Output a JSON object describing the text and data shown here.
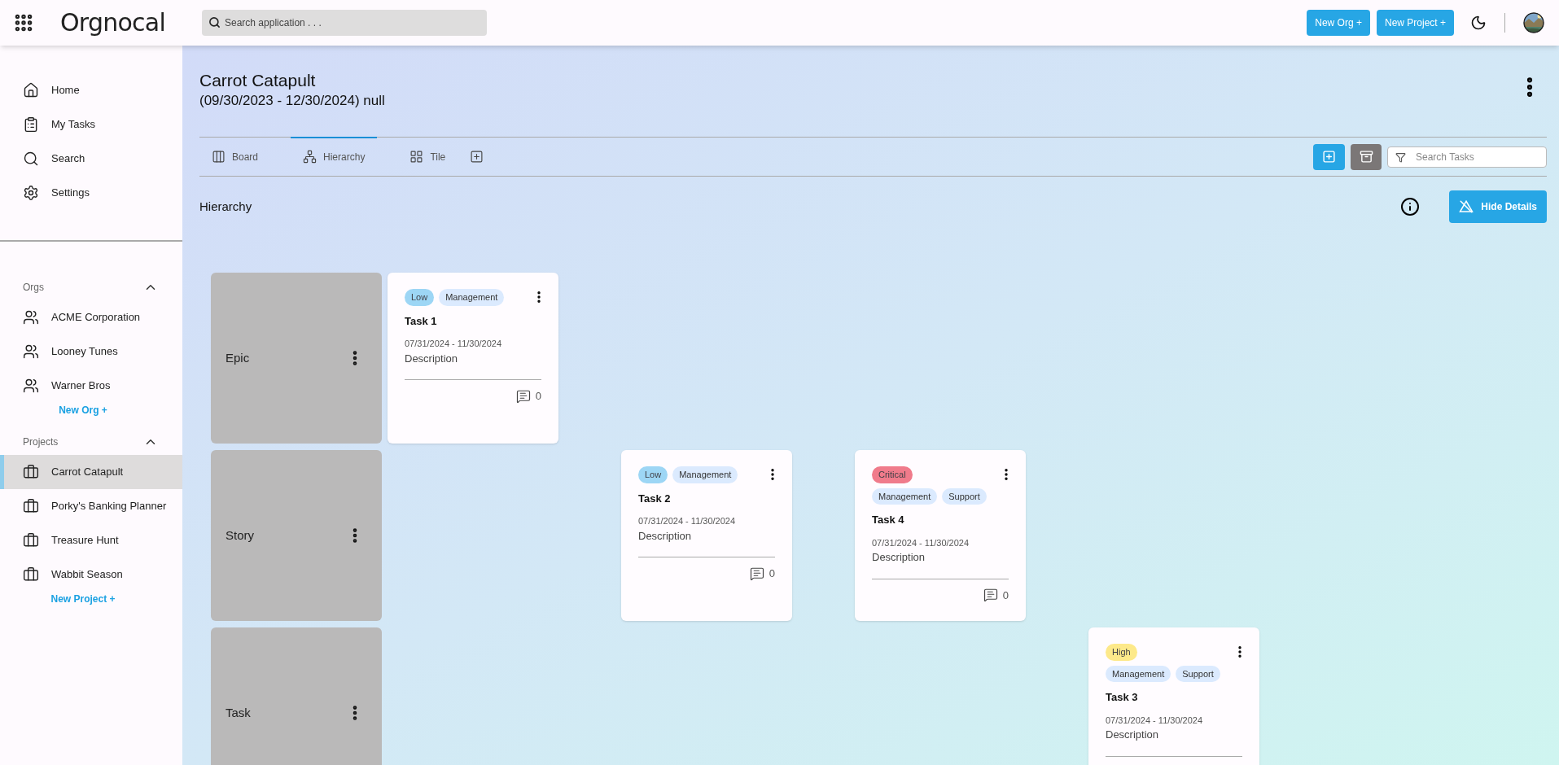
{
  "header": {
    "logo": "Orgnocal",
    "search_placeholder": "Search application . . .",
    "buttons": [
      "New Org +",
      "New Project +"
    ]
  },
  "sidebar": {
    "nav": [
      {
        "label": "Home",
        "kind": "home"
      },
      {
        "label": "My Tasks",
        "kind": "tasks"
      },
      {
        "label": "Search",
        "kind": "search"
      },
      {
        "label": "Settings",
        "kind": "settings"
      }
    ],
    "sections": [
      {
        "title": "Orgs",
        "kind": "org",
        "expanded": true,
        "items": [
          {
            "label": "ACME Corporation",
            "selected": false
          },
          {
            "label": "Looney Tunes",
            "selected": false
          },
          {
            "label": "Warner Bros",
            "selected": false
          }
        ],
        "add_link": "New Org +"
      },
      {
        "title": "Projects",
        "kind": "project",
        "expanded": true,
        "items": [
          {
            "label": "Carrot Catapult",
            "selected": true
          },
          {
            "label": "Porky's Banking Planner",
            "selected": false
          },
          {
            "label": "Treasure Hunt",
            "selected": false
          },
          {
            "label": "Wabbit Season",
            "selected": false
          }
        ],
        "add_link": "New Project +"
      }
    ]
  },
  "project": {
    "title": "Carrot Catapult",
    "subtitle": "(09/30/2023 - 12/30/2024) null"
  },
  "tabs": [
    {
      "label": "Board",
      "kind": "board",
      "selected": false
    },
    {
      "label": "Hierarchy",
      "kind": "hierarchy",
      "selected": true
    },
    {
      "label": "Tile",
      "kind": "tile",
      "selected": false
    },
    {
      "kind": "add",
      "selected": false
    }
  ],
  "task_search": {
    "placeholder": "Search Tasks"
  },
  "view": {
    "title": "Hierarchy",
    "details_button": "Hide Details"
  },
  "levels": [
    {
      "name": "Epic",
      "tasks": [
        {
          "title": "Task 1",
          "dates": "07/31/2024 - 11/30/2024",
          "description": "Description",
          "comments": "0",
          "tag_rows": [
            [
              {
                "label": "Low",
                "kind": "priority",
                "color": "#9dd6f5"
              },
              {
                "label": "Management",
                "kind": "label"
              }
            ]
          ]
        }
      ]
    },
    {
      "name": "Story",
      "tasks": [
        {
          "title": "Task 2",
          "dates": "07/31/2024 - 11/30/2024",
          "description": "Description",
          "comments": "0",
          "tag_rows": [
            [
              {
                "label": "Low",
                "kind": "priority",
                "color": "#9dd6f5"
              },
              {
                "label": "Management",
                "kind": "label"
              }
            ]
          ]
        },
        {
          "title": "Task 4",
          "dates": "07/31/2024 - 11/30/2024",
          "description": "Description",
          "comments": "0",
          "tag_rows": [
            [
              {
                "label": "Critical",
                "kind": "priority",
                "color": "#f07b8b"
              }
            ],
            [
              {
                "label": "Management",
                "kind": "label"
              },
              {
                "label": "Support",
                "kind": "label"
              }
            ]
          ]
        }
      ]
    },
    {
      "name": "Task",
      "tasks": [
        {
          "title": "Task 3",
          "dates": "07/31/2024 - 11/30/2024",
          "description": "Description",
          "tag_rows": [
            [
              {
                "label": "High",
                "kind": "priority",
                "color": "#fde98a"
              }
            ],
            [
              {
                "label": "Management",
                "kind": "label"
              },
              {
                "label": "Support",
                "kind": "label"
              }
            ]
          ]
        }
      ]
    }
  ]
}
